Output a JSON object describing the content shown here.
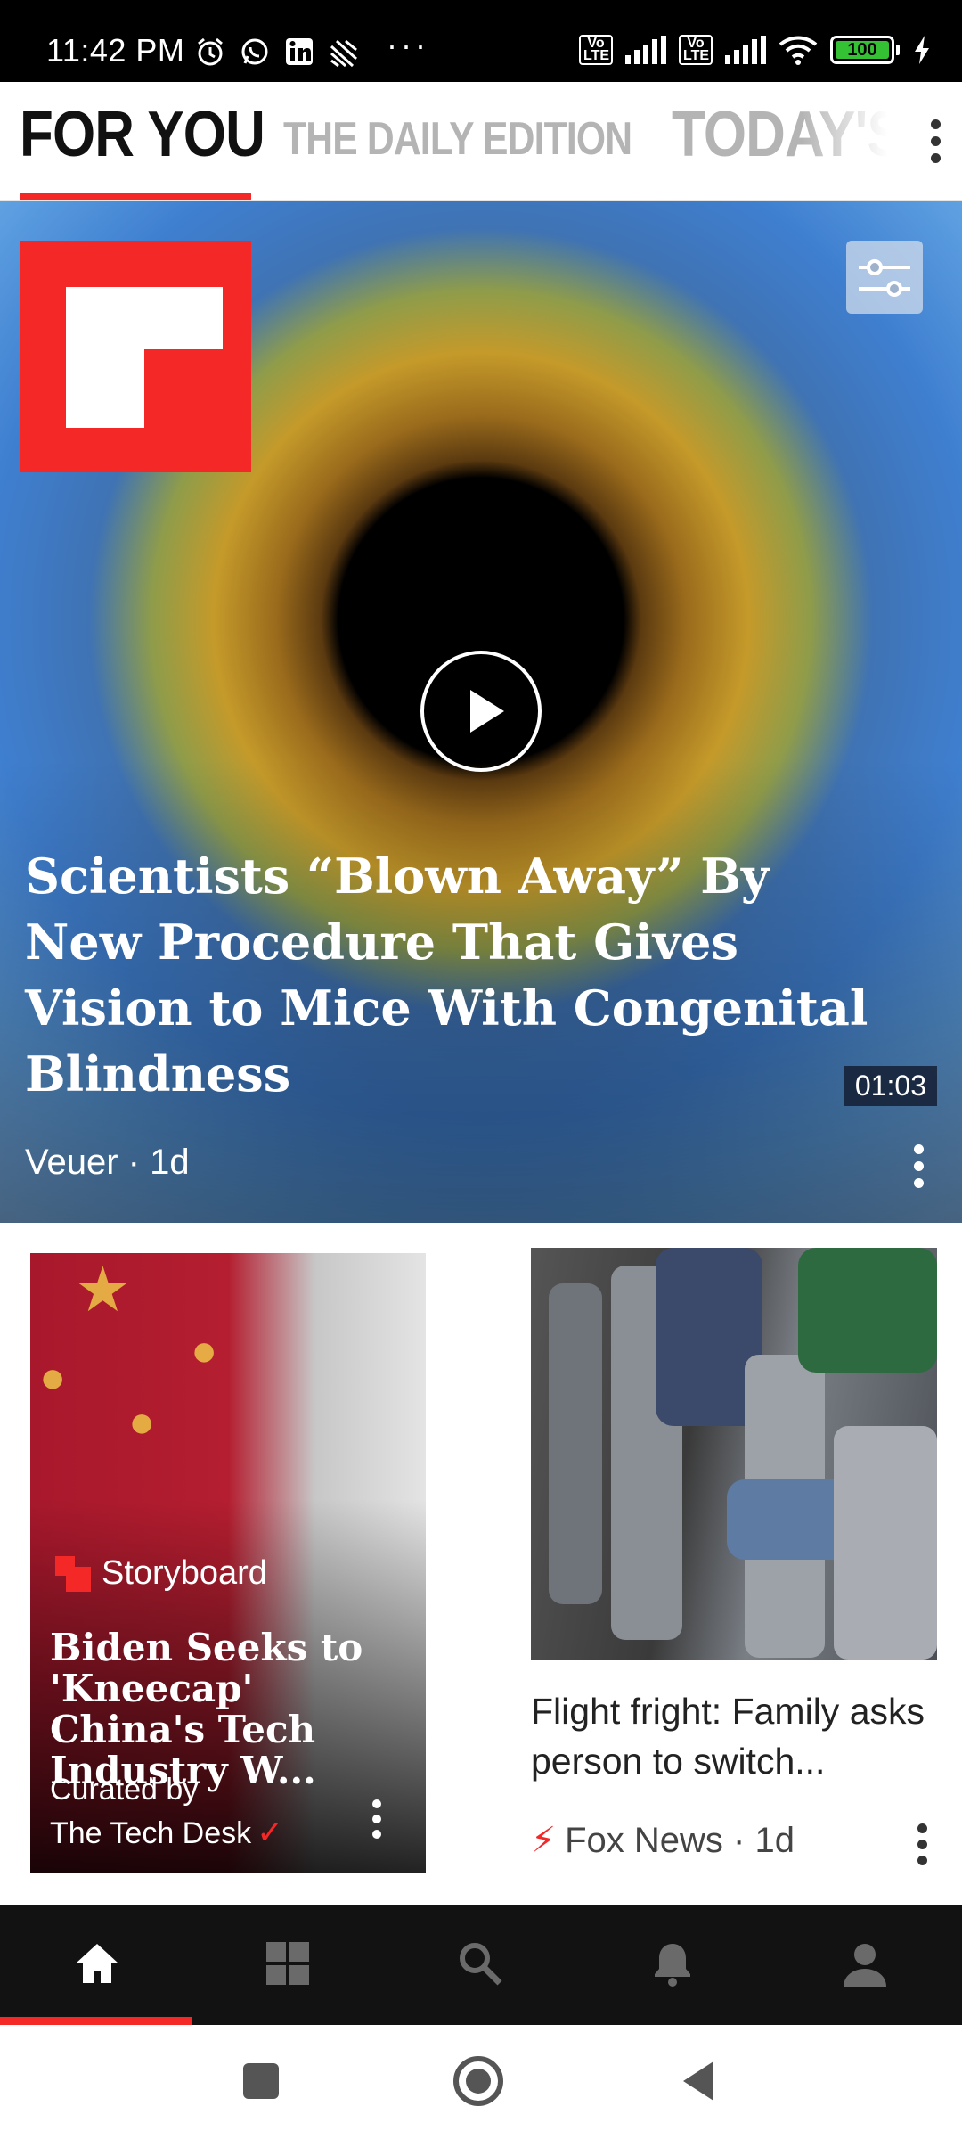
{
  "status_bar": {
    "time": "11:42 PM",
    "left_icons": [
      "alarm-icon",
      "whatsapp-icon",
      "linkedin-icon",
      "cast-icon"
    ],
    "overflow": "···",
    "volte_1": "Vo LTE",
    "volte_2": "Vo LTE",
    "battery_level": "100",
    "battery_color": "#34c134"
  },
  "tabs": {
    "items": [
      {
        "label": "FOR YOU",
        "active": true
      },
      {
        "label": "THE DAILY EDITION",
        "active": false
      },
      {
        "label": "TODAY'S",
        "active": false
      }
    ],
    "accent": "#f52828"
  },
  "hero": {
    "title": "Scientists “Blown Away” By New Procedure That Gives Vision to Mice With Congenital Blindness",
    "duration": "01:03",
    "source": "Veuer · 1d"
  },
  "cards": [
    {
      "badge": "Storyboard",
      "title": "Biden Seeks to 'Kneecap' China's Tech Industry W...",
      "curated_line_1": "Curated by",
      "curated_line_2": "The Tech Desk"
    },
    {
      "title": "Flight fright: Family asks person to switch...",
      "source": "Fox News · 1d"
    }
  ],
  "bottom_nav": {
    "items": [
      "home-icon",
      "grid-icon",
      "search-icon",
      "bell-icon",
      "profile-icon"
    ],
    "active_index": 0
  },
  "system_nav": [
    "recents-icon",
    "home-circle-icon",
    "back-icon"
  ]
}
